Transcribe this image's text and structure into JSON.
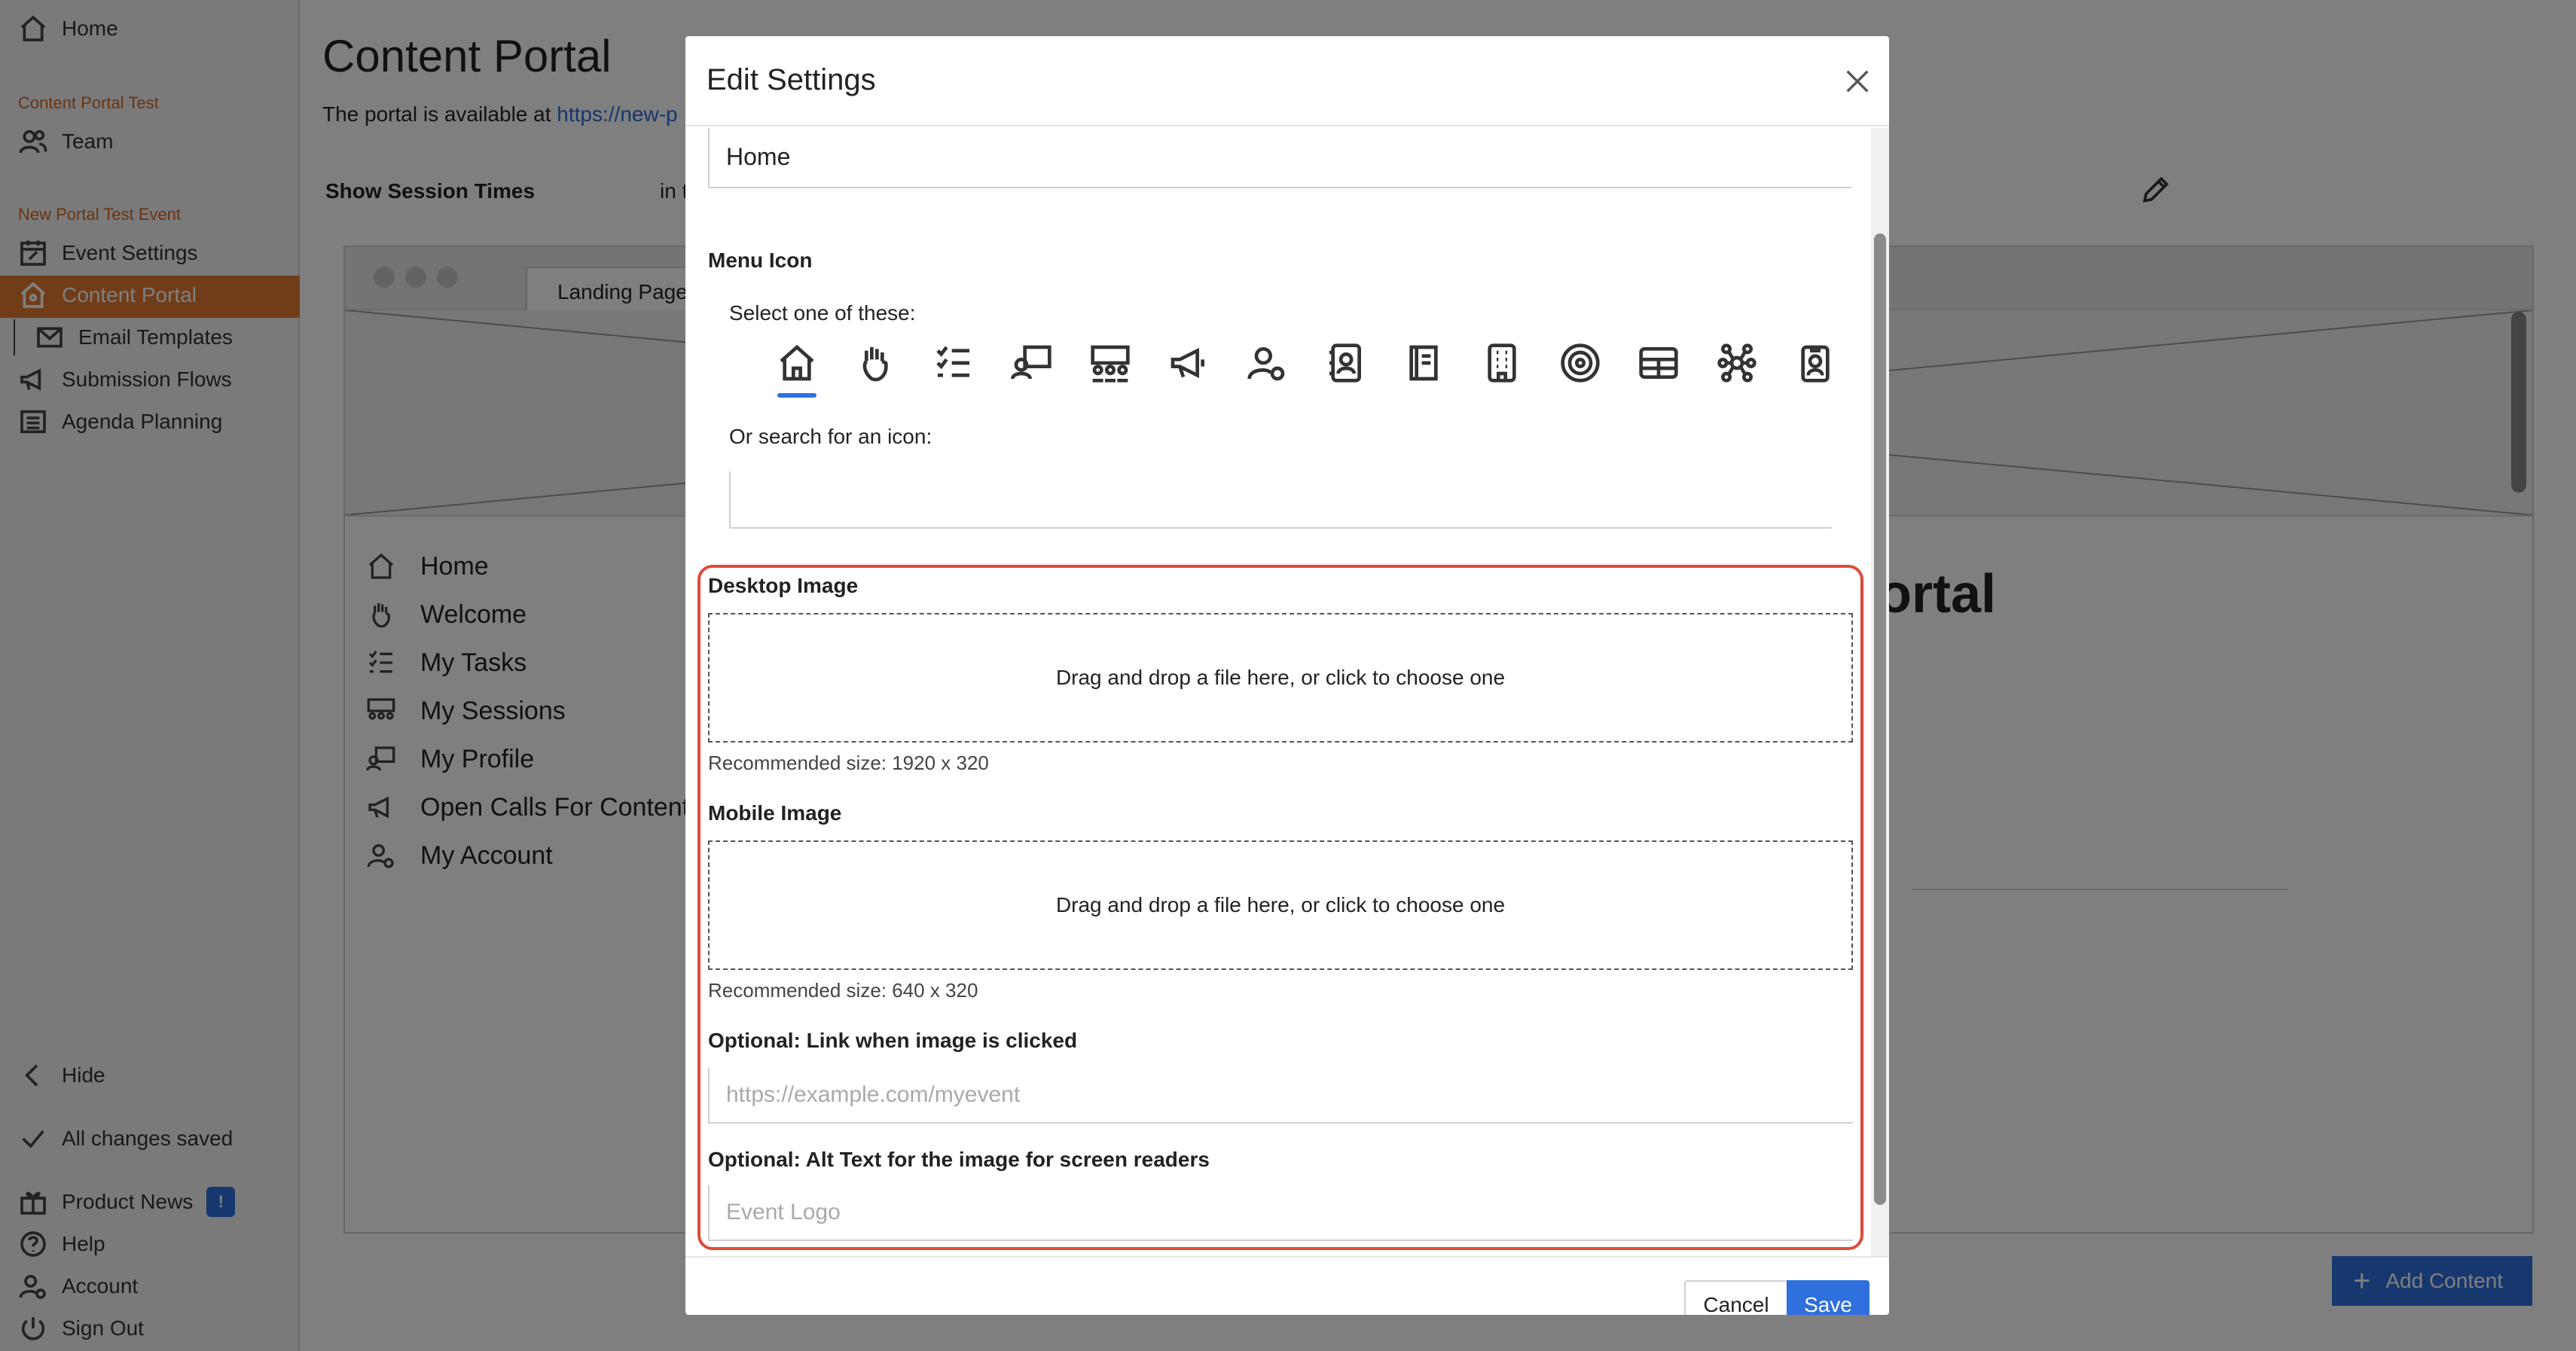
{
  "sidebar": {
    "home": "Home",
    "section1": "Content Portal Test",
    "team": "Team",
    "section2": "New Portal Test Event",
    "event_settings": "Event Settings",
    "content_portal": "Content Portal",
    "email_templates": "Email Templates",
    "submission_flows": "Submission Flows",
    "agenda_planning": "Agenda Planning",
    "hide": "Hide",
    "saved": "All changes saved",
    "product_news": "Product News",
    "product_news_badge": "!",
    "help": "Help",
    "account": "Account",
    "sign_out": "Sign Out"
  },
  "main": {
    "title": "Content Portal",
    "subtitle_prefix": "The portal is available at ",
    "subtitle_link": "https://new-p",
    "session_label": "Show Session Times",
    "session_in": "in t",
    "preview": {
      "tab": "Landing Page",
      "menu": [
        "Home",
        "Welcome",
        "My Tasks",
        "My Sessions",
        "My Profile",
        "Open Calls For Content",
        "My Account"
      ],
      "heading": "ortal"
    },
    "add_content": "Add Content"
  },
  "modal": {
    "title": "Edit Settings",
    "menu_label_value": "Home",
    "menu_icon_label": "Menu Icon",
    "select_label": "Select one of these:",
    "icons": [
      "home-icon",
      "wave-hand-icon",
      "checklist-icon",
      "presenter-icon",
      "audience-icon",
      "megaphone-icon",
      "user-settings-icon",
      "contact-card-icon",
      "book-icon",
      "building-icon",
      "target-icon",
      "table-icon",
      "network-icon",
      "badge-icon"
    ],
    "selected_icon": "home-icon",
    "search_label": "Or search for an icon:",
    "search_value": "",
    "desktop_label": "Desktop Image",
    "desktop_drop": "Drag and drop a file here, or click to choose one",
    "desktop_hint": "Recommended size: 1920 x 320",
    "mobile_label": "Mobile Image",
    "mobile_drop": "Drag and drop a file here, or click to choose one",
    "mobile_hint": "Recommended size: 640 x 320",
    "link_label": "Optional: Link when image is clicked",
    "link_placeholder": "https://example.com/myevent",
    "alt_label": "Optional: Alt Text for the image for screen readers",
    "alt_placeholder": "Event Logo",
    "cancel": "Cancel",
    "save": "Save"
  },
  "colors": {
    "accent": "#e07b30",
    "primary": "#2f6fde",
    "highlight": "#e04a3a"
  }
}
